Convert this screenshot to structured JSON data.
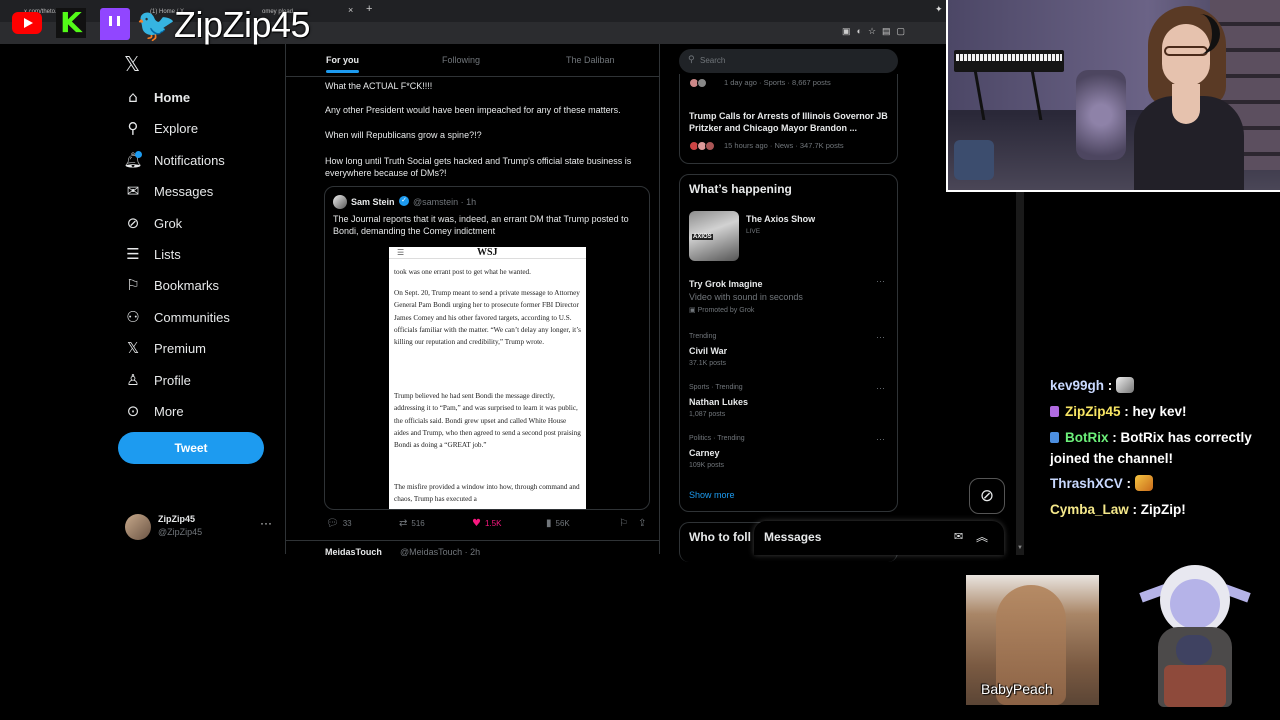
{
  "browser": {
    "tabs": [
      "x.com/theto...",
      "(1) Home / X",
      "omey plead..."
    ],
    "new_tab": "+",
    "close": "×"
  },
  "overlay": {
    "name": "ZipZip45",
    "logos": [
      "youtube-logo",
      "kick-logo",
      "twitch-logo",
      "twitter-bird-logo"
    ]
  },
  "nav": {
    "items": [
      {
        "label": "Home",
        "icon": "home-icon"
      },
      {
        "label": "Explore",
        "icon": "search-icon"
      },
      {
        "label": "Notifications",
        "icon": "bell-icon"
      },
      {
        "label": "Messages",
        "icon": "mail-icon"
      },
      {
        "label": "Grok",
        "icon": "grok-icon"
      },
      {
        "label": "Lists",
        "icon": "list-icon"
      },
      {
        "label": "Bookmarks",
        "icon": "bookmark-icon"
      },
      {
        "label": "Communities",
        "icon": "people-icon"
      },
      {
        "label": "Premium",
        "icon": "x-icon"
      },
      {
        "label": "Profile",
        "icon": "person-icon"
      },
      {
        "label": "More",
        "icon": "more-circle-icon"
      }
    ],
    "tweet_button": "Tweet",
    "account": {
      "name": "ZipZip45",
      "handle": "@ZipZip45"
    }
  },
  "feed": {
    "tabs": [
      "For you",
      "Following",
      "The Daliban"
    ],
    "tweet": {
      "lines": [
        "What the ACTUAL F*CK!!!!",
        "Any other President would have been impeached for any of these matters.",
        "When will Republicans grow a spine?!?",
        "How long until Truth Social gets hacked and Trump's official state business is everywhere because of DMs?!"
      ],
      "quote": {
        "name": "Sam Stein",
        "handle": "@samstein · 1h",
        "text": "The Journal reports that it was, indeed, an errant DM that Trump posted to Bondi, demanding the Comey indictment",
        "wsj_logo": "WSJ",
        "article": [
          "took was one errant post to get what he wanted.",
          "On Sept. 20, Trump meant to send a private message to Attorney General Pam Bondi urging her to prosecute former FBI Director James Comey and his other favored targets, according to U.S. officials familiar with the matter. “We can’t delay any longer, it’s killing our reputation and credibility,” Trump wrote.",
          "Trump believed he had sent Bondi the message directly, addressing it to “Pam,” and was surprised to learn it was public, the officials said. Bondi grew upset and called White House aides and Trump, who then agreed to send a second post praising Bondi as doing a “GREAT job.”",
          "The misfire provided a window into how, through command and chaos, Trump has executed a"
        ]
      },
      "actions": {
        "replies": "33",
        "reposts": "516",
        "likes": "1.5K",
        "views": "56K"
      }
    },
    "next": {
      "name": "MeidasTouch",
      "handle": "@MeidasTouch · 2h"
    }
  },
  "sidebar": {
    "search_placeholder": "Search",
    "news": [
      {
        "meta": "1 day ago · Sports · 8,667 posts"
      },
      {
        "title": "Trump Calls for Arrests of Illinois Governor JB Pritzker and Chicago Mayor Brandon ...",
        "meta": "15 hours ago · News · 347.7K posts"
      }
    ],
    "whats_happening": "What’s happening",
    "axios": {
      "title": "The Axios Show",
      "status": "LIVE",
      "img_text": "AXIOS"
    },
    "grok_promo": {
      "title": "Try Grok Imagine",
      "subtitle": "Video with sound in seconds",
      "promoted": "Promoted by Grok"
    },
    "trends": [
      {
        "context": "Trending",
        "name": "Civil War",
        "count": "37.1K posts"
      },
      {
        "context": "Sports · Trending",
        "name": "Nathan Lukes",
        "count": "1,087 posts"
      },
      {
        "context": "Politics · Trending",
        "name": "Carney",
        "count": "109K posts"
      }
    ],
    "show_more": "Show more",
    "who_to_follow": "Who to foll",
    "messages": "Messages"
  },
  "chat": [
    {
      "user": "kev99gh",
      "sep": " : ",
      "msg": "",
      "color": "#c9d9ff",
      "emote": "cat-emote"
    },
    {
      "user": "ZipZip45",
      "sep": " : ",
      "msg": "hey kev!",
      "color": "#f7e463",
      "badge": "mic-badge"
    },
    {
      "user": "BotRix",
      "sep": " : ",
      "msg": "BotRix has correctly joined the channel!",
      "color": "#6cf07a",
      "badge": "wrench-badge"
    },
    {
      "user": "ThrashXCV",
      "sep": " : ",
      "msg": "",
      "color": "#c9d9ff",
      "emote": "hype-emote"
    },
    {
      "user": "Cymba_Law",
      "sep": " : ",
      "msg": "ZipZip!",
      "color": "#f5e88a"
    }
  ],
  "baby_peach": "BabyPeach"
}
